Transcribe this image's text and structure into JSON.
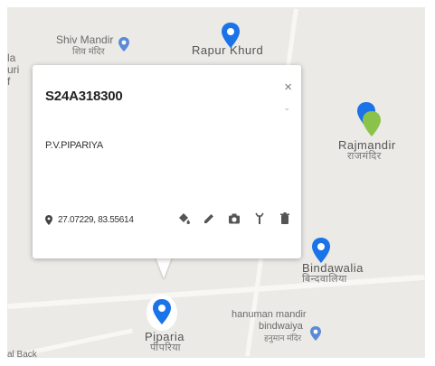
{
  "map": {
    "places": {
      "shiv_mandir": {
        "name": "Shiv Mandir",
        "local": "शिव मंदिर"
      },
      "rapur_khurd": {
        "name": "Rapur Khurd"
      },
      "rajmandir": {
        "name": "Rajmandir",
        "local": "राजमंदिर"
      },
      "bindawalia": {
        "name": "Bindawalia",
        "local": "बिन्दवालिया"
      },
      "hanuman_mandir": {
        "name": "hanuman mandir",
        "line2": "bindwaiya",
        "local": "हनुमान मंदिर"
      },
      "piparia": {
        "name": "Piparia",
        "local": "पीपरिया"
      },
      "left_edge": {
        "line1": "la",
        "line2": "uri"
      },
      "bottom_left": {
        "name": "al Back"
      }
    }
  },
  "popup": {
    "id": "S24A318300",
    "name": "P.V.PIPARIYA",
    "coords": "27.07229, 83.55614",
    "close_symbol": "×"
  },
  "colors": {
    "pin_blue": "#1a73e8",
    "pin_green": "#8bc34a",
    "map_bg": "#eceae6"
  },
  "icons": [
    "location-pin-icon",
    "paint-bucket-icon",
    "pencil-icon",
    "camera-icon",
    "wrench-icon",
    "trash-icon"
  ]
}
